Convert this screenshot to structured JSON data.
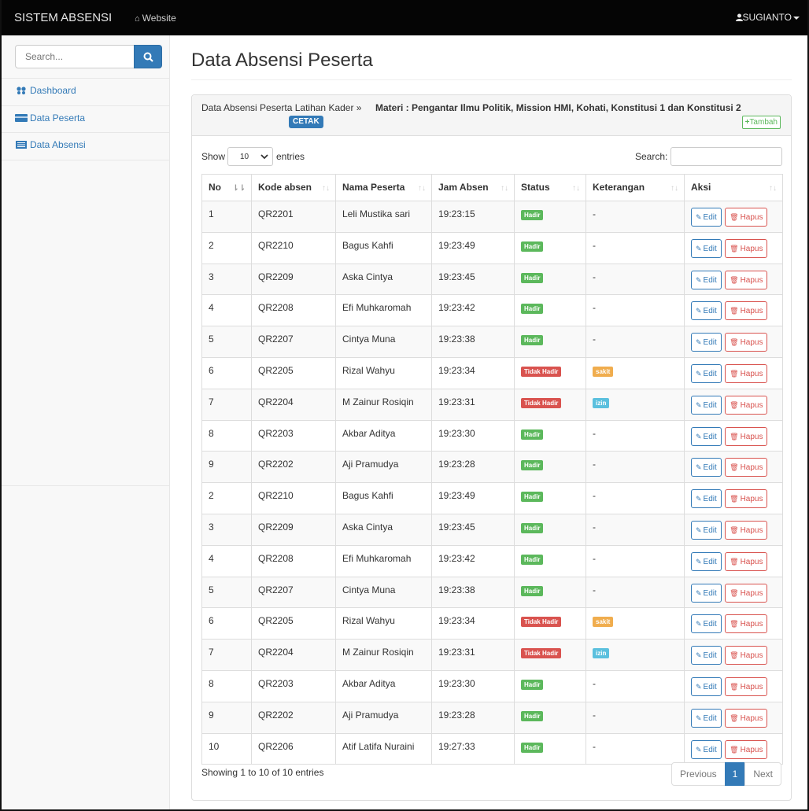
{
  "navbar": {
    "brand": "SISTEM ABSENSI",
    "website_link": "Website",
    "website_icon": "home-icon",
    "user": "SUGIANTO",
    "user_icon": "user-icon"
  },
  "sidebar": {
    "search_placeholder": "Search...",
    "items": [
      {
        "label": "Dashboard",
        "icon": "dashboard-icon"
      },
      {
        "label": "Data Peserta",
        "icon": "credit-card-icon"
      },
      {
        "label": "Data Absensi",
        "icon": "list-icon"
      }
    ]
  },
  "page": {
    "title": "Data Absensi Peserta"
  },
  "panel": {
    "breadcrumb": "Data Absensi Peserta Latihan Kader  »",
    "materi": "Materi :  Pengantar Ilmu Politik, Mission HMI, Kohati, Konstitusi 1 dan Konstitusi 2",
    "cetak_label": "CETAK",
    "tambah_label": "Tambah"
  },
  "table_controls": {
    "show_label": "Show",
    "length_value": "10",
    "entries_label": "entries",
    "search_label": "Search:"
  },
  "table": {
    "columns": [
      "No",
      "Kode absen",
      "Nama Peserta",
      "Jam Absen",
      "Status",
      "Keterangan",
      "Aksi"
    ],
    "edit_label": "Edit",
    "hapus_label": "Hapus",
    "rows": [
      {
        "no": "1",
        "kode": "QR2201",
        "nama": "Leli Mustika sari",
        "jam": "19:23:15",
        "status": "Hadir",
        "ket": "-"
      },
      {
        "no": "2",
        "kode": "QR2210",
        "nama": "Bagus Kahfi",
        "jam": "19:23:49",
        "status": "Hadir",
        "ket": "-"
      },
      {
        "no": "3",
        "kode": "QR2209",
        "nama": "Aska Cintya",
        "jam": "19:23:45",
        "status": "Hadir",
        "ket": "-"
      },
      {
        "no": "4",
        "kode": "QR2208",
        "nama": "Efi Muhkaromah",
        "jam": "19:23:42",
        "status": "Hadir",
        "ket": "-"
      },
      {
        "no": "5",
        "kode": "QR2207",
        "nama": "Cintya Muna",
        "jam": "19:23:38",
        "status": "Hadir",
        "ket": "-"
      },
      {
        "no": "6",
        "kode": "QR2205",
        "nama": "Rizal Wahyu",
        "jam": "19:23:34",
        "status": "Tidak Hadir",
        "ket": "sakit"
      },
      {
        "no": "7",
        "kode": "QR2204",
        "nama": "M Zainur Rosiqin",
        "jam": "19:23:31",
        "status": "Tidak Hadir",
        "ket": "izin"
      },
      {
        "no": "8",
        "kode": "QR2203",
        "nama": "Akbar Aditya",
        "jam": "19:23:30",
        "status": "Hadir",
        "ket": "-"
      },
      {
        "no": "9",
        "kode": "QR2202",
        "nama": "Aji Pramudya",
        "jam": "19:23:28",
        "status": "Hadir",
        "ket": "-"
      },
      {
        "no": "2",
        "kode": "QR2210",
        "nama": "Bagus Kahfi",
        "jam": "19:23:49",
        "status": "Hadir",
        "ket": "-"
      },
      {
        "no": "3",
        "kode": "QR2209",
        "nama": "Aska Cintya",
        "jam": "19:23:45",
        "status": "Hadir",
        "ket": "-"
      },
      {
        "no": "4",
        "kode": "QR2208",
        "nama": "Efi Muhkaromah",
        "jam": "19:23:42",
        "status": "Hadir",
        "ket": "-"
      },
      {
        "no": "5",
        "kode": "QR2207",
        "nama": "Cintya Muna",
        "jam": "19:23:38",
        "status": "Hadir",
        "ket": "-"
      },
      {
        "no": "6",
        "kode": "QR2205",
        "nama": "Rizal Wahyu",
        "jam": "19:23:34",
        "status": "Tidak Hadir",
        "ket": "sakit"
      },
      {
        "no": "7",
        "kode": "QR2204",
        "nama": "M Zainur Rosiqin",
        "jam": "19:23:31",
        "status": "Tidak Hadir",
        "ket": "izin"
      },
      {
        "no": "8",
        "kode": "QR2203",
        "nama": "Akbar Aditya",
        "jam": "19:23:30",
        "status": "Hadir",
        "ket": "-"
      },
      {
        "no": "9",
        "kode": "QR2202",
        "nama": "Aji Pramudya",
        "jam": "19:23:28",
        "status": "Hadir",
        "ket": "-"
      },
      {
        "no": "10",
        "kode": "QR2206",
        "nama": "Atif Latifa Nuraini",
        "jam": "19:27:33",
        "status": "Hadir",
        "ket": "-"
      }
    ]
  },
  "footer": {
    "info": "Showing 1 to 10 of 10 entries",
    "previous_label": "Previous",
    "current_page": "1",
    "next_label": "Next"
  },
  "colors": {
    "primary": "#337ab7",
    "success": "#5cb85c",
    "danger": "#d9534f",
    "warning": "#f0ad4e",
    "info": "#5bc0de",
    "navbar": "#050505"
  }
}
